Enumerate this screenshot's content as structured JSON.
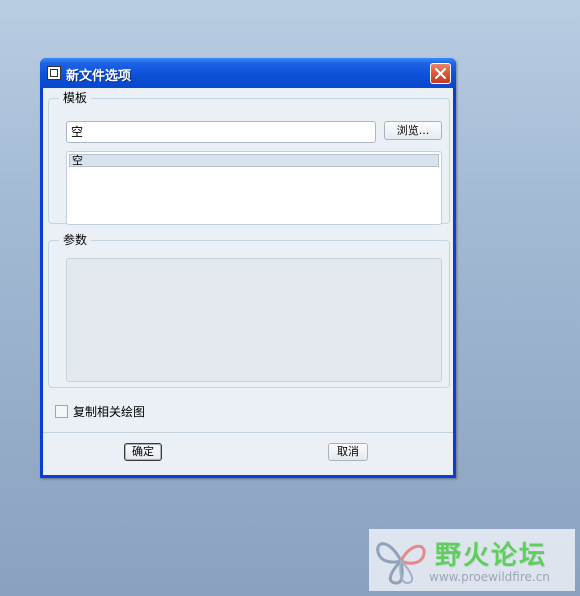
{
  "dialog": {
    "title": "新文件选项",
    "template_group": {
      "label": "模板",
      "value": "空",
      "browse_label": "浏览...",
      "list_items": [
        "空"
      ]
    },
    "params_group": {
      "label": "参数"
    },
    "copy_drawings": {
      "label": "复制相关绘图",
      "checked": false
    },
    "ok_label": "确定",
    "cancel_label": "取消"
  },
  "watermark": {
    "title": "野火论坛",
    "url": "www.proewildfire.cn"
  },
  "icons": {
    "window": "window-icon",
    "close": "close-icon",
    "logo": "butterfly-logo-icon"
  }
}
